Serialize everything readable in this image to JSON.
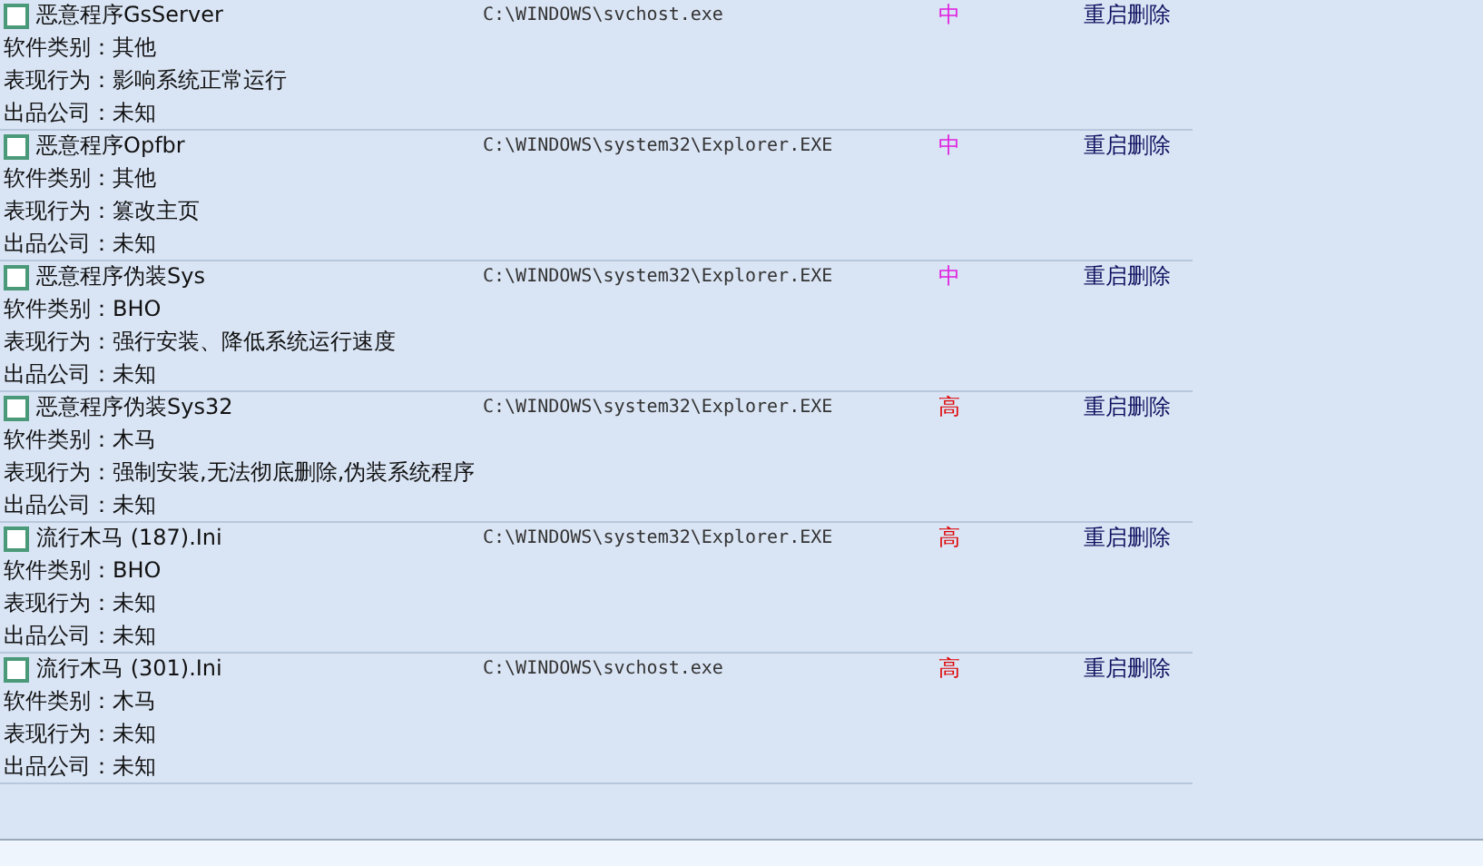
{
  "items": [
    {
      "name": "恶意程序GsServer",
      "checked": false,
      "path": "C:\\WINDOWS\\svchost.exe",
      "risk": {
        "text": "中",
        "color": "#e020e0"
      },
      "action": "重启删除",
      "details": [
        "软件类别：其他",
        "表现行为：影响系统正常运行",
        "出品公司：未知"
      ]
    },
    {
      "name": "恶意程序Opfbr",
      "checked": false,
      "path": "C:\\WINDOWS\\system32\\Explorer.EXE",
      "risk": {
        "text": "中",
        "color": "#e020e0"
      },
      "action": "重启删除",
      "details": [
        "软件类别：其他",
        "表现行为：篡改主页",
        "出品公司：未知"
      ]
    },
    {
      "name": "恶意程序伪装Sys",
      "checked": false,
      "path": "C:\\WINDOWS\\system32\\Explorer.EXE",
      "risk": {
        "text": "中",
        "color": "#e020e0"
      },
      "action": "重启删除",
      "details": [
        "软件类别：BHO",
        "表现行为：强行安装、降低系统运行速度",
        "出品公司：未知"
      ]
    },
    {
      "name": "恶意程序伪装Sys32",
      "checked": false,
      "path": "C:\\WINDOWS\\system32\\Explorer.EXE",
      "risk": {
        "text": "高",
        "color": "#e00000"
      },
      "action": "重启删除",
      "details": [
        "软件类别：木马",
        "表现行为：强制安装,无法彻底删除,伪装系统程序",
        "出品公司：未知"
      ]
    },
    {
      "name": "流行木马 (187).Ini",
      "checked": false,
      "path": "C:\\WINDOWS\\system32\\Explorer.EXE",
      "risk": {
        "text": "高",
        "color": "#e00000"
      },
      "action": "重启删除",
      "details": [
        "软件类别：BHO",
        "表现行为：未知",
        "出品公司：未知"
      ]
    },
    {
      "name": "流行木马 (301).Ini",
      "checked": false,
      "path": "C:\\WINDOWS\\svchost.exe",
      "risk": {
        "text": "高",
        "color": "#e00000"
      },
      "action": "重启删除",
      "details": [
        "软件类别：木马",
        "表现行为：未知",
        "出品公司：未知"
      ]
    }
  ]
}
